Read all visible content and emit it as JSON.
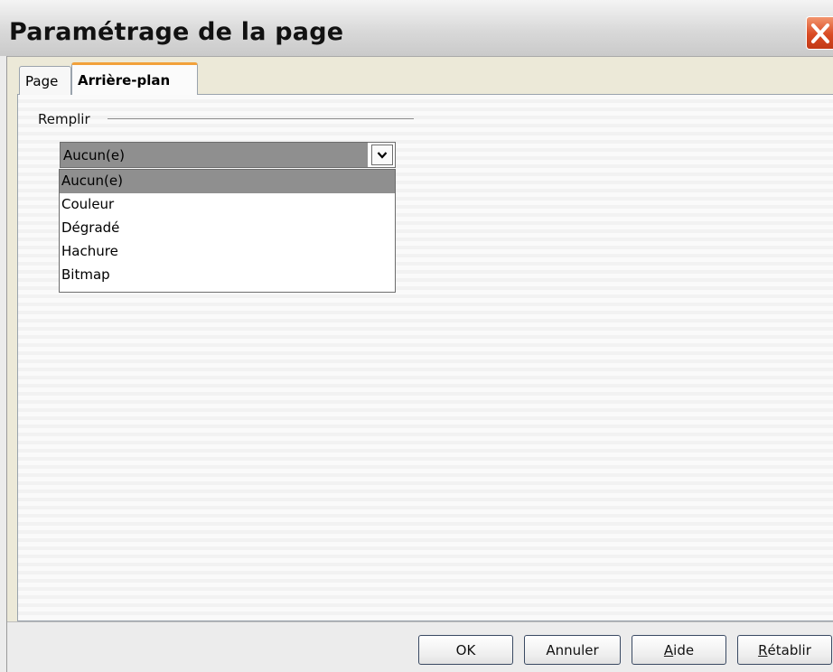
{
  "window": {
    "title": "Paramétrage de la page"
  },
  "tabs": [
    {
      "label": "Page",
      "active": false
    },
    {
      "label": "Arrière-plan",
      "active": true
    }
  ],
  "fill": {
    "group_label": "Remplir",
    "selected_value": "Aucun(e)",
    "options": [
      "Aucun(e)",
      "Couleur",
      "Dégradé",
      "Hachure",
      "Bitmap"
    ]
  },
  "buttons": {
    "ok": "OK",
    "cancel": "Annuler",
    "help_first": "A",
    "help_rest": "ide",
    "reset_first": "R",
    "reset_rest": "établir"
  },
  "colors": {
    "selection": "#8f8f8f",
    "tab_accent": "#f2a13a",
    "close_button": "#d94a23"
  }
}
